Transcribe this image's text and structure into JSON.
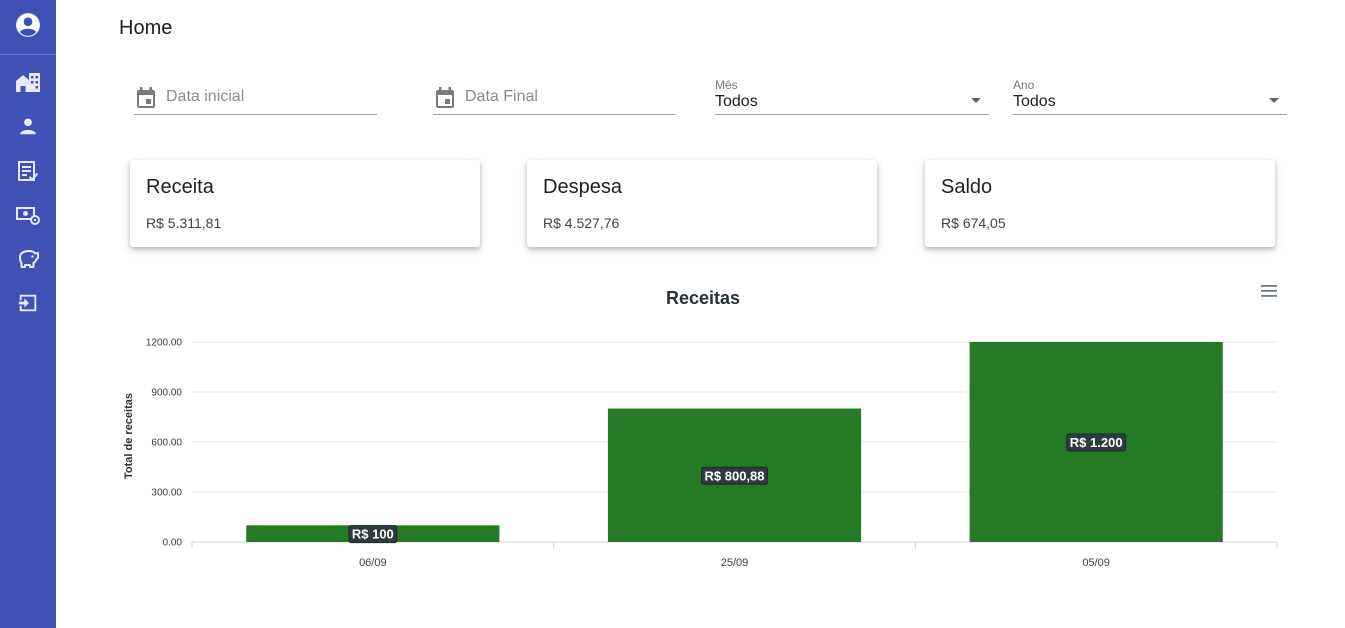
{
  "page": {
    "title": "Home"
  },
  "sidebar": {
    "items": [
      {
        "icon": "account-circle-icon"
      },
      {
        "icon": "buildings-icon"
      },
      {
        "icon": "person-icon"
      },
      {
        "icon": "list-check-icon"
      },
      {
        "icon": "money-settings-icon"
      },
      {
        "icon": "piggy-bank-icon"
      },
      {
        "icon": "exit-icon"
      }
    ],
    "color": "#3f51b5"
  },
  "filters": {
    "start_date_placeholder": "Data inicial",
    "end_date_placeholder": "Data Final",
    "month": {
      "label": "Mês",
      "value": "Todos"
    },
    "year": {
      "label": "Ano",
      "value": "Todos"
    }
  },
  "cards": [
    {
      "title": "Receita",
      "value": "R$ 5.311,81"
    },
    {
      "title": "Despesa",
      "value": "R$ 4.527,76"
    },
    {
      "title": "Saldo",
      "value": "R$ 674,05"
    }
  ],
  "chart_data": {
    "type": "bar",
    "title": "Receitas",
    "xlabel": "",
    "ylabel": "Total de receitas",
    "categories": [
      "06/09",
      "25/09",
      "05/09"
    ],
    "values": [
      100,
      800.88,
      1200
    ],
    "data_labels": [
      "R$ 100",
      "R$ 800,88",
      "R$ 1.200"
    ],
    "ylim": [
      0,
      1200
    ],
    "yticks": [
      "0.00",
      "300.00",
      "600.00",
      "900.00",
      "1200.00"
    ],
    "grid": true,
    "bar_color": "#267a26"
  }
}
